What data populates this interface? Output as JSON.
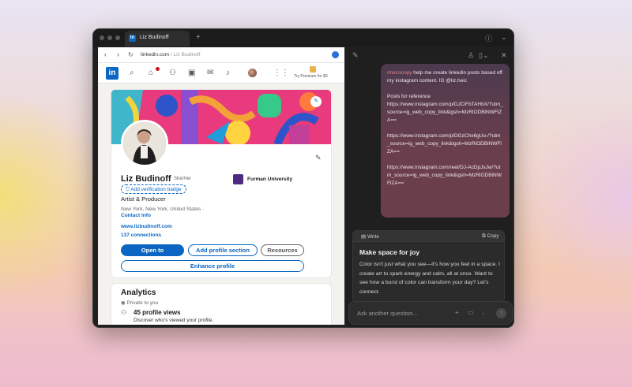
{
  "browser": {
    "tab_title": "Liz Budinoff",
    "tab_plus": "+",
    "url_domain": "linkedin.com",
    "url_path": " / Liz Budinoff"
  },
  "linkedin_nav": {
    "logo": "in",
    "premium": "Try Premium for $0",
    "notifications_badge_color": "#cc1016"
  },
  "profile": {
    "name": "Liz Budinoff",
    "pronouns": "She/Her",
    "verify": "Add verification badge",
    "university": "Furman University",
    "headline": "Artist & Producer",
    "location": "New York, New York, United States ·",
    "contact": "Contact info",
    "website": "www.lizbudinoff.com",
    "connections": "137 connections",
    "btn_open": "Open to",
    "btn_add": "Add profile section",
    "btn_resources": "Resources",
    "btn_enhance": "Enhance profile"
  },
  "analytics": {
    "title": "Analytics",
    "private": "Private to you",
    "views": "45 profile views",
    "views_sub": "Discover who's viewed your profile."
  },
  "assistant": {
    "user_cmd": "/microcopy",
    "user_msg": " help me create linkedin posts based off my instagram content. IG @liz.heic\n\nPosts for reference\nhttps://www.instagram.com/p/DJClFbTAHbX/?utm_source=ig_web_copy_link&igsh=MzRlODBiNWFlZA==\n\nhttps://www.instagram.com/p/DGzChx6gUo-/?utm_source=ig_web_copy_link&igsh=MzRlODBiNWFlZA==\n\nhttps://www.instagram.com/reel/DJ-AcDpJsJw/?utm_source=ig_web_copy_link&igsh=MzRlODBiNWFlZA==",
    "write_label": "Write",
    "copy_label": "Copy",
    "post_title": "Make space for joy",
    "post_body": "Color isn't just what you see—it's how you feel in a space. I create art to spark energy and calm, all at once. Want to see how a burst of color can transform your day? Let's connect.",
    "ask_placeholder": "Ask another question..."
  },
  "colors": {
    "linkedin_blue": "#0a66c2",
    "user_bubble": "#6a3e4c",
    "command": "#e4828f"
  }
}
